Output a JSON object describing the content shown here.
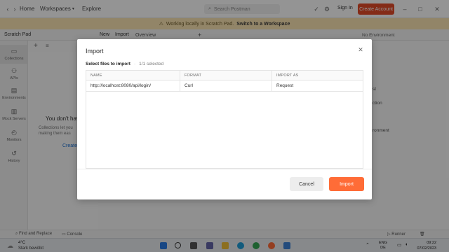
{
  "header": {
    "home": "Home",
    "workspaces": "Workspaces",
    "explore": "Explore",
    "search_placeholder": "Search Postman",
    "sign_in": "Sign In",
    "create_account": "Create Account"
  },
  "banner": {
    "text": "Working locally in Scratch Pad.",
    "link": "Switch to a Workspace"
  },
  "scratch": {
    "title": "Scratch Pad",
    "new": "New",
    "import": "Import",
    "overview_tab": "Overview",
    "environment": "No Environment"
  },
  "sidebar": {
    "items": [
      {
        "label": "Collections",
        "icon": "collections-icon"
      },
      {
        "label": "APIs",
        "icon": "api-icon"
      },
      {
        "label": "Environments",
        "icon": "environment-icon"
      },
      {
        "label": "Mock Servers",
        "icon": "mock-server-icon"
      },
      {
        "label": "Monitors",
        "icon": "monitor-icon"
      },
      {
        "label": "History",
        "icon": "history-icon"
      }
    ]
  },
  "empty_state": {
    "title": "You don't hav",
    "desc_line1": "Collections let you",
    "desc_line2": "making them eas",
    "link": "Create"
  },
  "right_fragments": {
    "a": "st",
    "b": "ction",
    "c": "ronment"
  },
  "footer": {
    "find_replace": "Find and Replace",
    "console": "Console",
    "runner": "Runner"
  },
  "taskbar": {
    "temp": "4°C",
    "weather": "Stark bewölkt",
    "lang1": "ENG",
    "lang2": "DE",
    "time": "09:22",
    "date": "07/02/2023"
  },
  "dialog": {
    "title": "Import",
    "select_label": "Select files to import",
    "separator": "·",
    "selected_count": "1/1 selected",
    "columns": [
      "NAME",
      "FORMAT",
      "IMPORT AS"
    ],
    "rows": [
      {
        "name": "http://localhost:8080/api/login/",
        "format": "Curl",
        "import_as": "Request"
      }
    ],
    "cancel": "Cancel",
    "import": "Import"
  }
}
